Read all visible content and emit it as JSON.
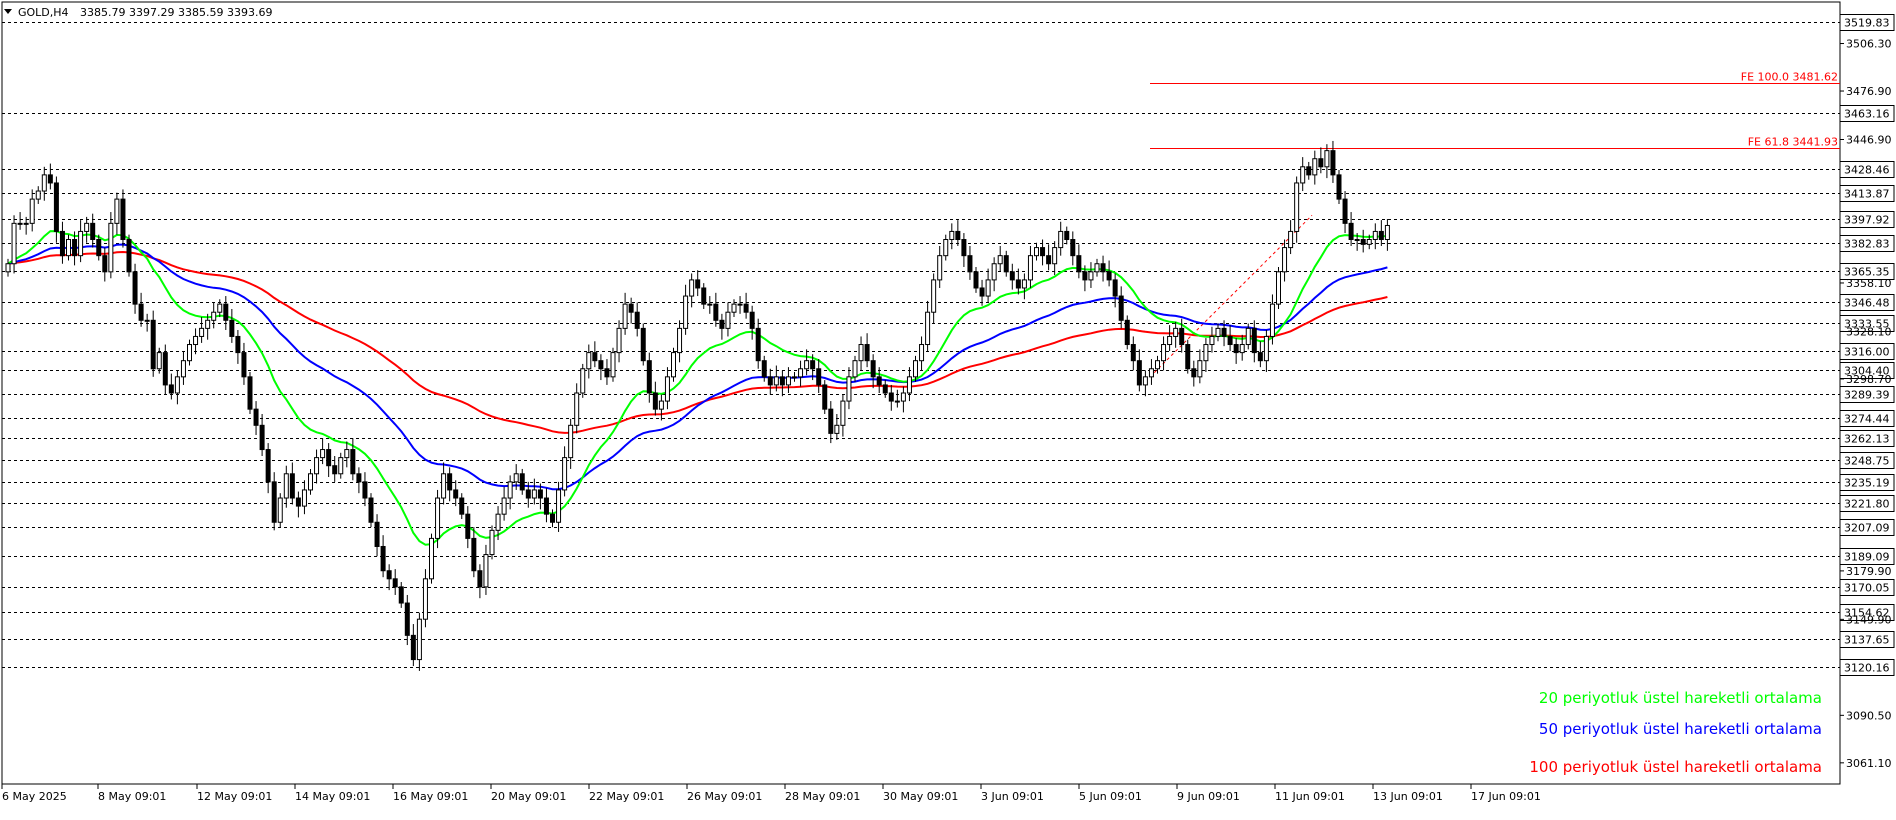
{
  "header": {
    "symbol": "GOLD,H4",
    "ohlc": "3385.79 3397.29 3385.59 3393.69"
  },
  "colors": {
    "bull": "#ffffff",
    "bear": "#000000",
    "ema20": "#00ff00",
    "ema50": "#0000ff",
    "ema100": "#ff0000",
    "fib": "#ff0000",
    "grid": "#000000"
  },
  "legend": [
    {
      "label": "20 periyotluk üstel hareketli ortalama",
      "color": "#00ff00"
    },
    {
      "label": "50 periyotluk üstel hareketli ortalama",
      "color": "#0000ff"
    },
    {
      "label": "100 periyotluk üstel hareketli ortalama",
      "color": "#ff0000"
    }
  ],
  "fib_levels": [
    {
      "label": "FE 100.0 3481.62",
      "value": 3481.62
    },
    {
      "label": "FE 61.8 3441.93",
      "value": 3441.93
    }
  ],
  "chart_data": {
    "type": "candlestick",
    "ylim": [
      3048,
      3532
    ],
    "y_ticks": [
      3506.3,
      3476.9,
      3446.9,
      3358.1,
      3328.1,
      3298.7,
      3179.9,
      3149.9,
      3090.5,
      3061.1
    ],
    "level_lines": [
      3519.83,
      3463.16,
      3428.46,
      3413.87,
      3397.92,
      3382.83,
      3365.35,
      3346.48,
      3333.55,
      3316.0,
      3304.4,
      3289.39,
      3274.44,
      3262.13,
      3248.75,
      3235.19,
      3221.8,
      3207.09,
      3189.09,
      3170.05,
      3154.62,
      3137.65,
      3120.16
    ],
    "x_labels": [
      "6 May 2025",
      "8 May 09:01",
      "12 May 09:01",
      "14 May 09:01",
      "16 May 09:01",
      "20 May 09:01",
      "22 May 09:01",
      "26 May 09:01",
      "28 May 09:01",
      "30 May 09:01",
      "3 Jun 09:01",
      "5 Jun 09:01",
      "9 Jun 09:01",
      "11 Jun 09:01",
      "13 Jun 09:01",
      "17 Jun 09:01"
    ],
    "closes": [
      3370,
      3395,
      3395,
      3395,
      3410,
      3415,
      3425,
      3420,
      3390,
      3375,
      3385,
      3375,
      3390,
      3395,
      3385,
      3375,
      3365,
      3395,
      3410,
      3385,
      3365,
      3345,
      3335,
      3335,
      3305,
      3315,
      3295,
      3290,
      3300,
      3310,
      3320,
      3325,
      3330,
      3335,
      3340,
      3345,
      3335,
      3325,
      3315,
      3300,
      3280,
      3270,
      3255,
      3235,
      3210,
      3225,
      3240,
      3225,
      3220,
      3230,
      3240,
      3250,
      3255,
      3245,
      3240,
      3250,
      3255,
      3240,
      3235,
      3225,
      3210,
      3195,
      3180,
      3175,
      3170,
      3160,
      3140,
      3125,
      3150,
      3175,
      3200,
      3225,
      3240,
      3230,
      3225,
      3215,
      3200,
      3180,
      3170,
      3190,
      3205,
      3215,
      3225,
      3235,
      3240,
      3230,
      3225,
      3230,
      3225,
      3215,
      3210,
      3230,
      3250,
      3270,
      3290,
      3305,
      3315,
      3310,
      3305,
      3300,
      3315,
      3330,
      3345,
      3340,
      3330,
      3310,
      3290,
      3280,
      3285,
      3300,
      3315,
      3330,
      3350,
      3360,
      3355,
      3345,
      3345,
      3335,
      3330,
      3340,
      3345,
      3345,
      3340,
      3330,
      3310,
      3300,
      3295,
      3300,
      3295,
      3300,
      3300,
      3305,
      3310,
      3305,
      3295,
      3280,
      3265,
      3270,
      3285,
      3300,
      3310,
      3320,
      3310,
      3300,
      3295,
      3290,
      3285,
      3285,
      3290,
      3300,
      3310,
      3320,
      3340,
      3360,
      3375,
      3385,
      3390,
      3385,
      3375,
      3365,
      3355,
      3350,
      3360,
      3370,
      3375,
      3365,
      3360,
      3355,
      3360,
      3375,
      3380,
      3375,
      3370,
      3380,
      3390,
      3385,
      3375,
      3365,
      3360,
      3365,
      3370,
      3365,
      3360,
      3350,
      3335,
      3320,
      3310,
      3295,
      3300,
      3305,
      3310,
      3320,
      3325,
      3330,
      3320,
      3305,
      3300,
      3310,
      3320,
      3325,
      3330,
      3325,
      3320,
      3315,
      3320,
      3330,
      3315,
      3310,
      3325,
      3345,
      3365,
      3380,
      3390,
      3420,
      3430,
      3425,
      3435,
      3430,
      3440,
      3425,
      3410,
      3395,
      3385,
      3385,
      3382,
      3385,
      3390,
      3385,
      3393.69
    ]
  }
}
